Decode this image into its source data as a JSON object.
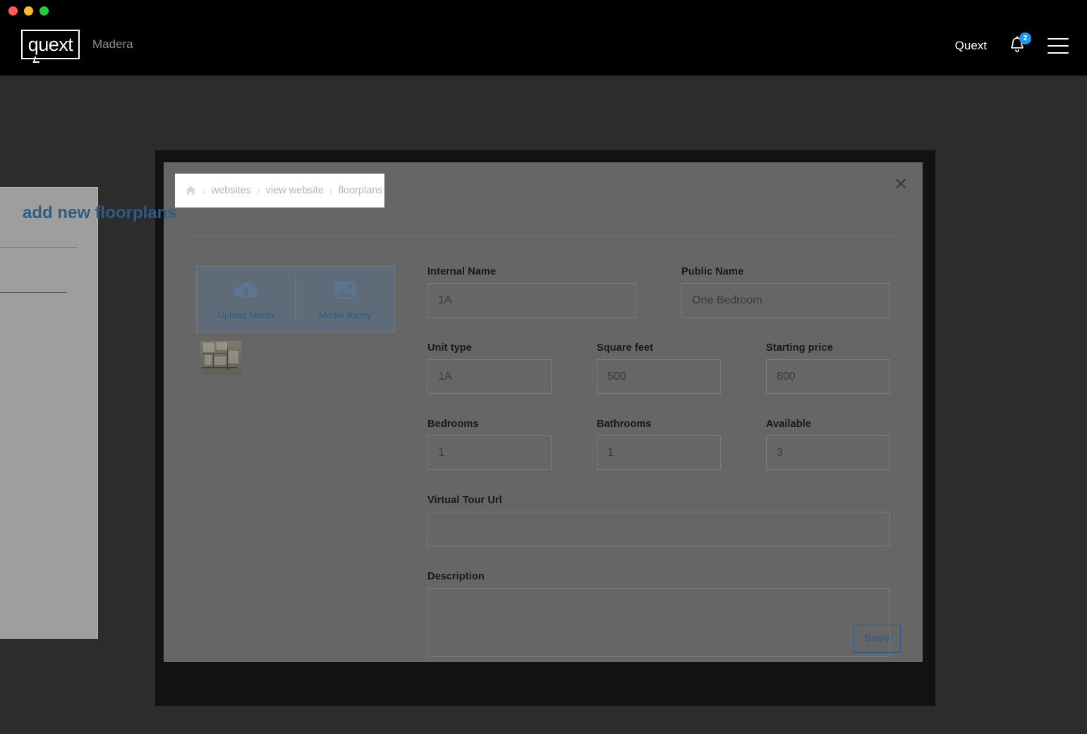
{
  "window": {
    "traffic_lights": [
      {
        "name": "close",
        "color": "#ff5f57"
      },
      {
        "name": "minimize",
        "color": "#febc2e"
      },
      {
        "name": "maximize",
        "color": "#28c840"
      }
    ]
  },
  "header": {
    "logo_text": "quext",
    "property_name": "Madera",
    "account_name": "Quext",
    "notification_count": "2",
    "notification_icon": "bell-icon",
    "menu_icon": "hamburger-menu-icon"
  },
  "modal": {
    "close_icon": "close-icon",
    "close_glyph": "✕",
    "title": "add new floorplans",
    "breadcrumb": {
      "home_icon": "home-icon",
      "separator": "›",
      "items": [
        {
          "label": "websites"
        },
        {
          "label": "view website"
        },
        {
          "label": "floorplans"
        }
      ]
    },
    "media": {
      "upload": {
        "icon": "cloud-upload-icon",
        "label": "Upload Media"
      },
      "library": {
        "icon": "image-icon",
        "label": "Media library"
      },
      "thumbnail_name": "floorplan-thumbnail"
    },
    "form": {
      "internal_name": {
        "label": "Internal Name",
        "value": "1A"
      },
      "public_name": {
        "label": "Public Name",
        "value": "One Bedroom"
      },
      "unit_type": {
        "label": "Unit type",
        "value": "1A"
      },
      "square_feet": {
        "label": "Square feet",
        "value": "500"
      },
      "starting_price": {
        "label": "Starting price",
        "value": "800"
      },
      "bedrooms": {
        "label": "Bedrooms",
        "value": "1"
      },
      "bathrooms": {
        "label": "Bathrooms",
        "value": "1"
      },
      "available": {
        "label": "Available",
        "value": "3"
      },
      "virtual_tour_url": {
        "label": "Virtual Tour Url",
        "value": ""
      },
      "description": {
        "label": "Description",
        "value": ""
      }
    },
    "save_label": "Save"
  },
  "colors": {
    "accent_blue": "#2d5c85",
    "badge_blue": "#2196f3",
    "modal_surface": "#666666",
    "modal_frame": "#121212",
    "page_backdrop": "#2c2c2c",
    "titlebar": "#000000"
  }
}
